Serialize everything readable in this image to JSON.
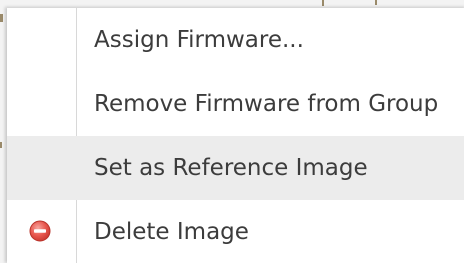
{
  "context_menu": {
    "items": [
      {
        "label": "Assign Firmware...",
        "icon": "",
        "highlighted": false
      },
      {
        "label": "Remove Firmware from Group",
        "icon": "",
        "highlighted": false
      },
      {
        "label": "Set as Reference Image",
        "icon": "",
        "highlighted": true
      },
      {
        "label": "Delete Image",
        "icon": "delete-icon",
        "highlighted": false
      }
    ]
  },
  "colors": {
    "highlight_background": "#ececec",
    "delete_icon": "#e8584f",
    "text": "#3c3c3c"
  }
}
